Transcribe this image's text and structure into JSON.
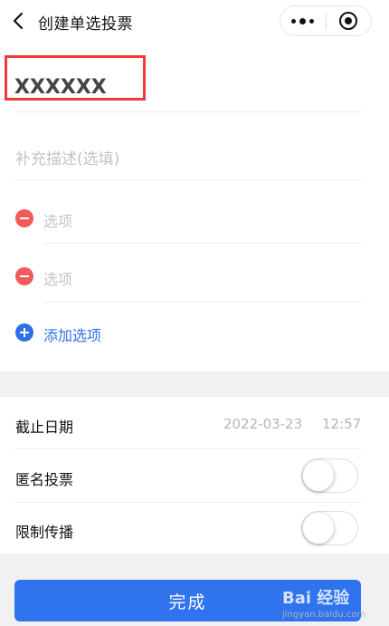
{
  "header": {
    "title": "创建单选投票",
    "back_icon": "chevron-left-icon",
    "menu_icon": "more-dots-icon",
    "close_icon": "target-icon"
  },
  "form": {
    "title_value": "XXXXXX",
    "description_placeholder": "补充描述(选填)",
    "options": [
      {
        "placeholder": "选项"
      },
      {
        "placeholder": "选项"
      }
    ],
    "add_option_label": "添加选项"
  },
  "settings": {
    "deadline": {
      "label": "截止日期",
      "date": "2022-03-23",
      "time": "12:57"
    },
    "anonymous": {
      "label": "匿名投票",
      "enabled": false
    },
    "restrict_share": {
      "label": "限制传播",
      "enabled": false
    }
  },
  "footer": {
    "done_label": "完成"
  },
  "watermark": {
    "brand": "Bai 经验",
    "site": "jingyan.baidu.com"
  },
  "colors": {
    "accent": "#2f73ee",
    "remove": "#f25b5b",
    "highlight_box": "#f23a3a"
  }
}
